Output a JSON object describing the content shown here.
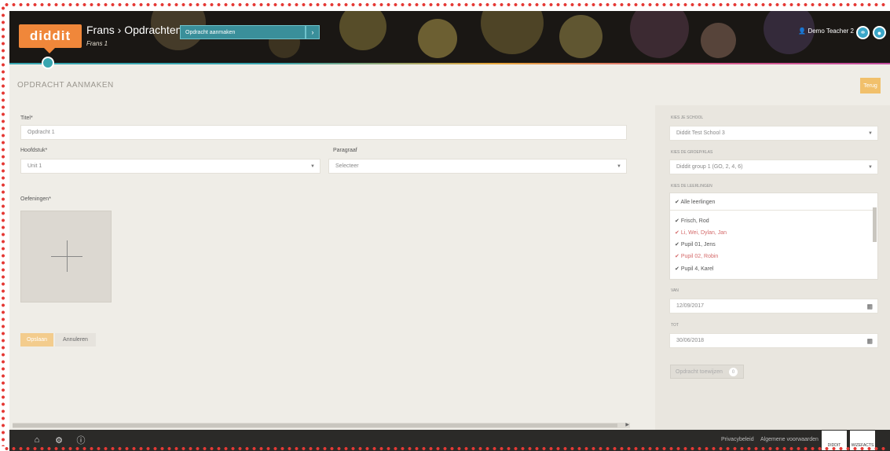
{
  "header": {
    "logo": "diddit",
    "breadcrumb": "Frans › Opdrachten ›",
    "sub": "Frans 1",
    "current_input": "Opdracht aanmaken",
    "user_name": "Demo Teacher 2",
    "accent": "#f0873a"
  },
  "page": {
    "title": "OPDRACHT AANMAKEN",
    "back_label": "Terug"
  },
  "form": {
    "title_label": "Titel*",
    "title_value": "Opdracht 1",
    "module_label": "Hoofdstuk*",
    "module_value": "Unit 1",
    "paragraph_label": "Paragraaf",
    "paragraph_value": "Selecteer",
    "exercises_label": "Oefeningen*",
    "save_label": "Opslaan",
    "cancel_label": "Annuleren"
  },
  "sidebar": {
    "school_label": "KIES JE SCHOOL",
    "school_value": "Diddit Test School 3",
    "group_label": "KIES DE GROEP/KLAS",
    "group_value": "Diddit group 1 (GO, 2, 4, 6)",
    "students_label": "KIES DE LEERLINGEN",
    "select_all": "Alle leerlingen",
    "students": [
      {
        "name": "Frisch, Rod",
        "red": false
      },
      {
        "name": "Li, Wei, Dylan, Jan",
        "red": true
      },
      {
        "name": "Pupil 01, Jens",
        "red": false
      },
      {
        "name": "Pupil 02, Robin",
        "red": true
      },
      {
        "name": "Pupil 4, Karel",
        "red": false
      }
    ],
    "from_label": "VAN",
    "from_value": "12/09/2017",
    "to_label": "TOT",
    "to_value": "30/06/2018",
    "assign_label": "Opdracht toewijzen",
    "assign_count": "0"
  },
  "footer": {
    "link1": "Privacybeleid",
    "link2": "Algemene voorwaarden",
    "tile1": "DIDDIT",
    "tile2": "WIZEFACTS"
  }
}
